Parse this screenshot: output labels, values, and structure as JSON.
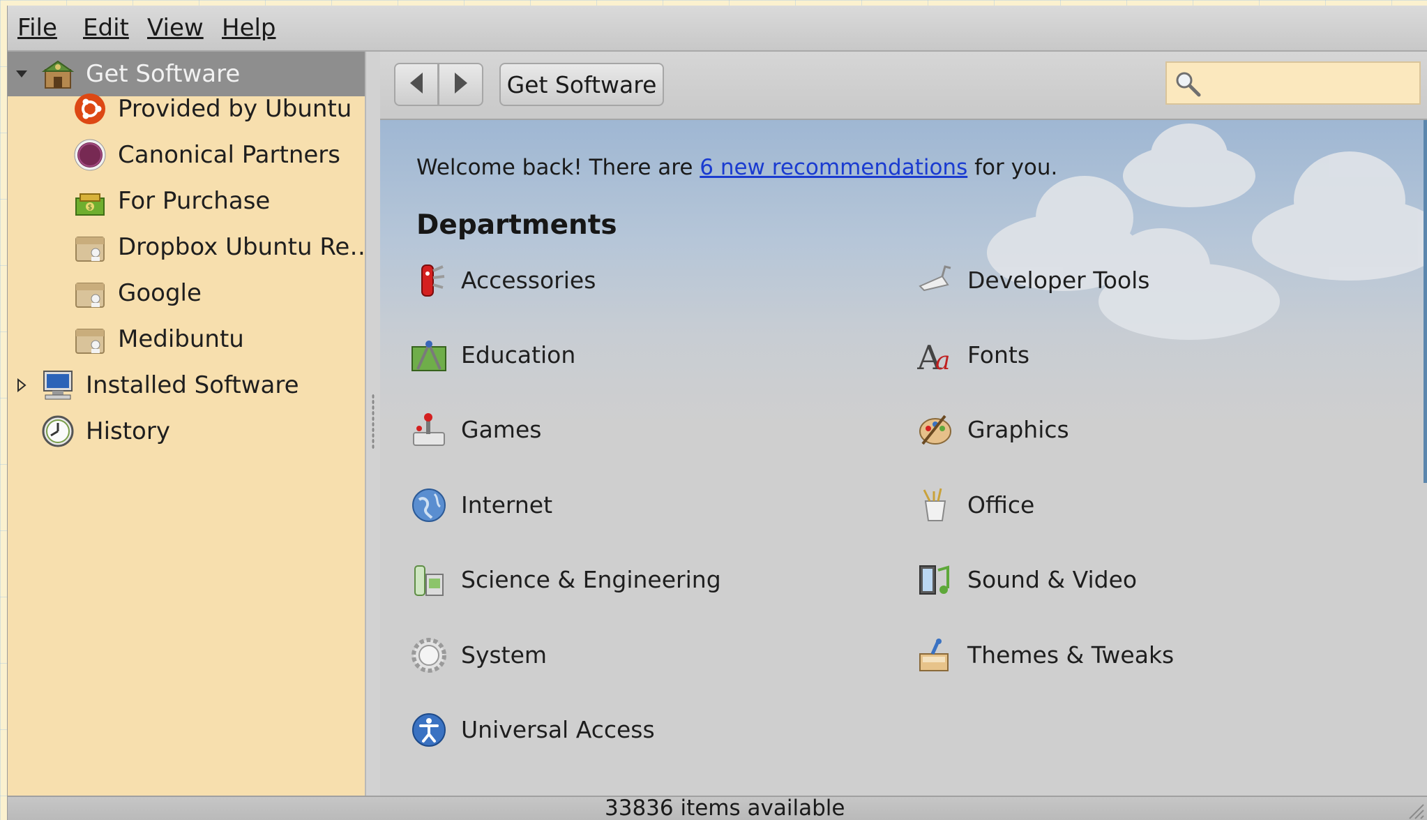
{
  "menu": {
    "file": "File",
    "edit": "Edit",
    "view": "View",
    "help": "Help"
  },
  "sidebar": {
    "items": [
      {
        "label": "Get Software",
        "icon": "get-software-icon",
        "selected": true
      },
      {
        "label": "Provided by Ubuntu",
        "icon": "ubuntu-logo-icon"
      },
      {
        "label": "Canonical Partners",
        "icon": "canonical-partners-icon"
      },
      {
        "label": "For Purchase",
        "icon": "for-purchase-icon"
      },
      {
        "label": "Dropbox Ubuntu Re…",
        "icon": "software-source-icon"
      },
      {
        "label": "Google",
        "icon": "software-source-icon"
      },
      {
        "label": "Medibuntu",
        "icon": "software-source-icon"
      },
      {
        "label": "Installed Software",
        "icon": "installed-software-icon"
      },
      {
        "label": "History",
        "icon": "history-icon"
      }
    ]
  },
  "toolbar": {
    "breadcrumb": "Get Software",
    "search_placeholder": ""
  },
  "main": {
    "welcome_prefix": "Welcome back! There are ",
    "welcome_link": "6 new recommendations",
    "welcome_suffix": " for you.",
    "departments_title": "Departments",
    "departments": [
      {
        "label": "Accessories",
        "icon": "accessories-icon"
      },
      {
        "label": "Developer Tools",
        "icon": "developer-tools-icon"
      },
      {
        "label": "Education",
        "icon": "education-icon"
      },
      {
        "label": "Fonts",
        "icon": "fonts-icon"
      },
      {
        "label": "Games",
        "icon": "games-icon"
      },
      {
        "label": "Graphics",
        "icon": "graphics-icon"
      },
      {
        "label": "Internet",
        "icon": "internet-icon"
      },
      {
        "label": "Office",
        "icon": "office-icon"
      },
      {
        "label": "Science & Engineering",
        "icon": "science-icon"
      },
      {
        "label": "Sound & Video",
        "icon": "sound-video-icon"
      },
      {
        "label": "System",
        "icon": "system-icon"
      },
      {
        "label": "Themes & Tweaks",
        "icon": "themes-tweaks-icon"
      },
      {
        "label": "Universal Access",
        "icon": "universal-access-icon"
      }
    ]
  },
  "status": {
    "items_available": "33836 items available"
  },
  "colors": {
    "sidebar_bg": "#f7dfae",
    "selected_bg": "#8e8e8e",
    "link": "#1a3bd0",
    "ubuntu_orange": "#dd4814",
    "canonical_purple": "#772953"
  }
}
